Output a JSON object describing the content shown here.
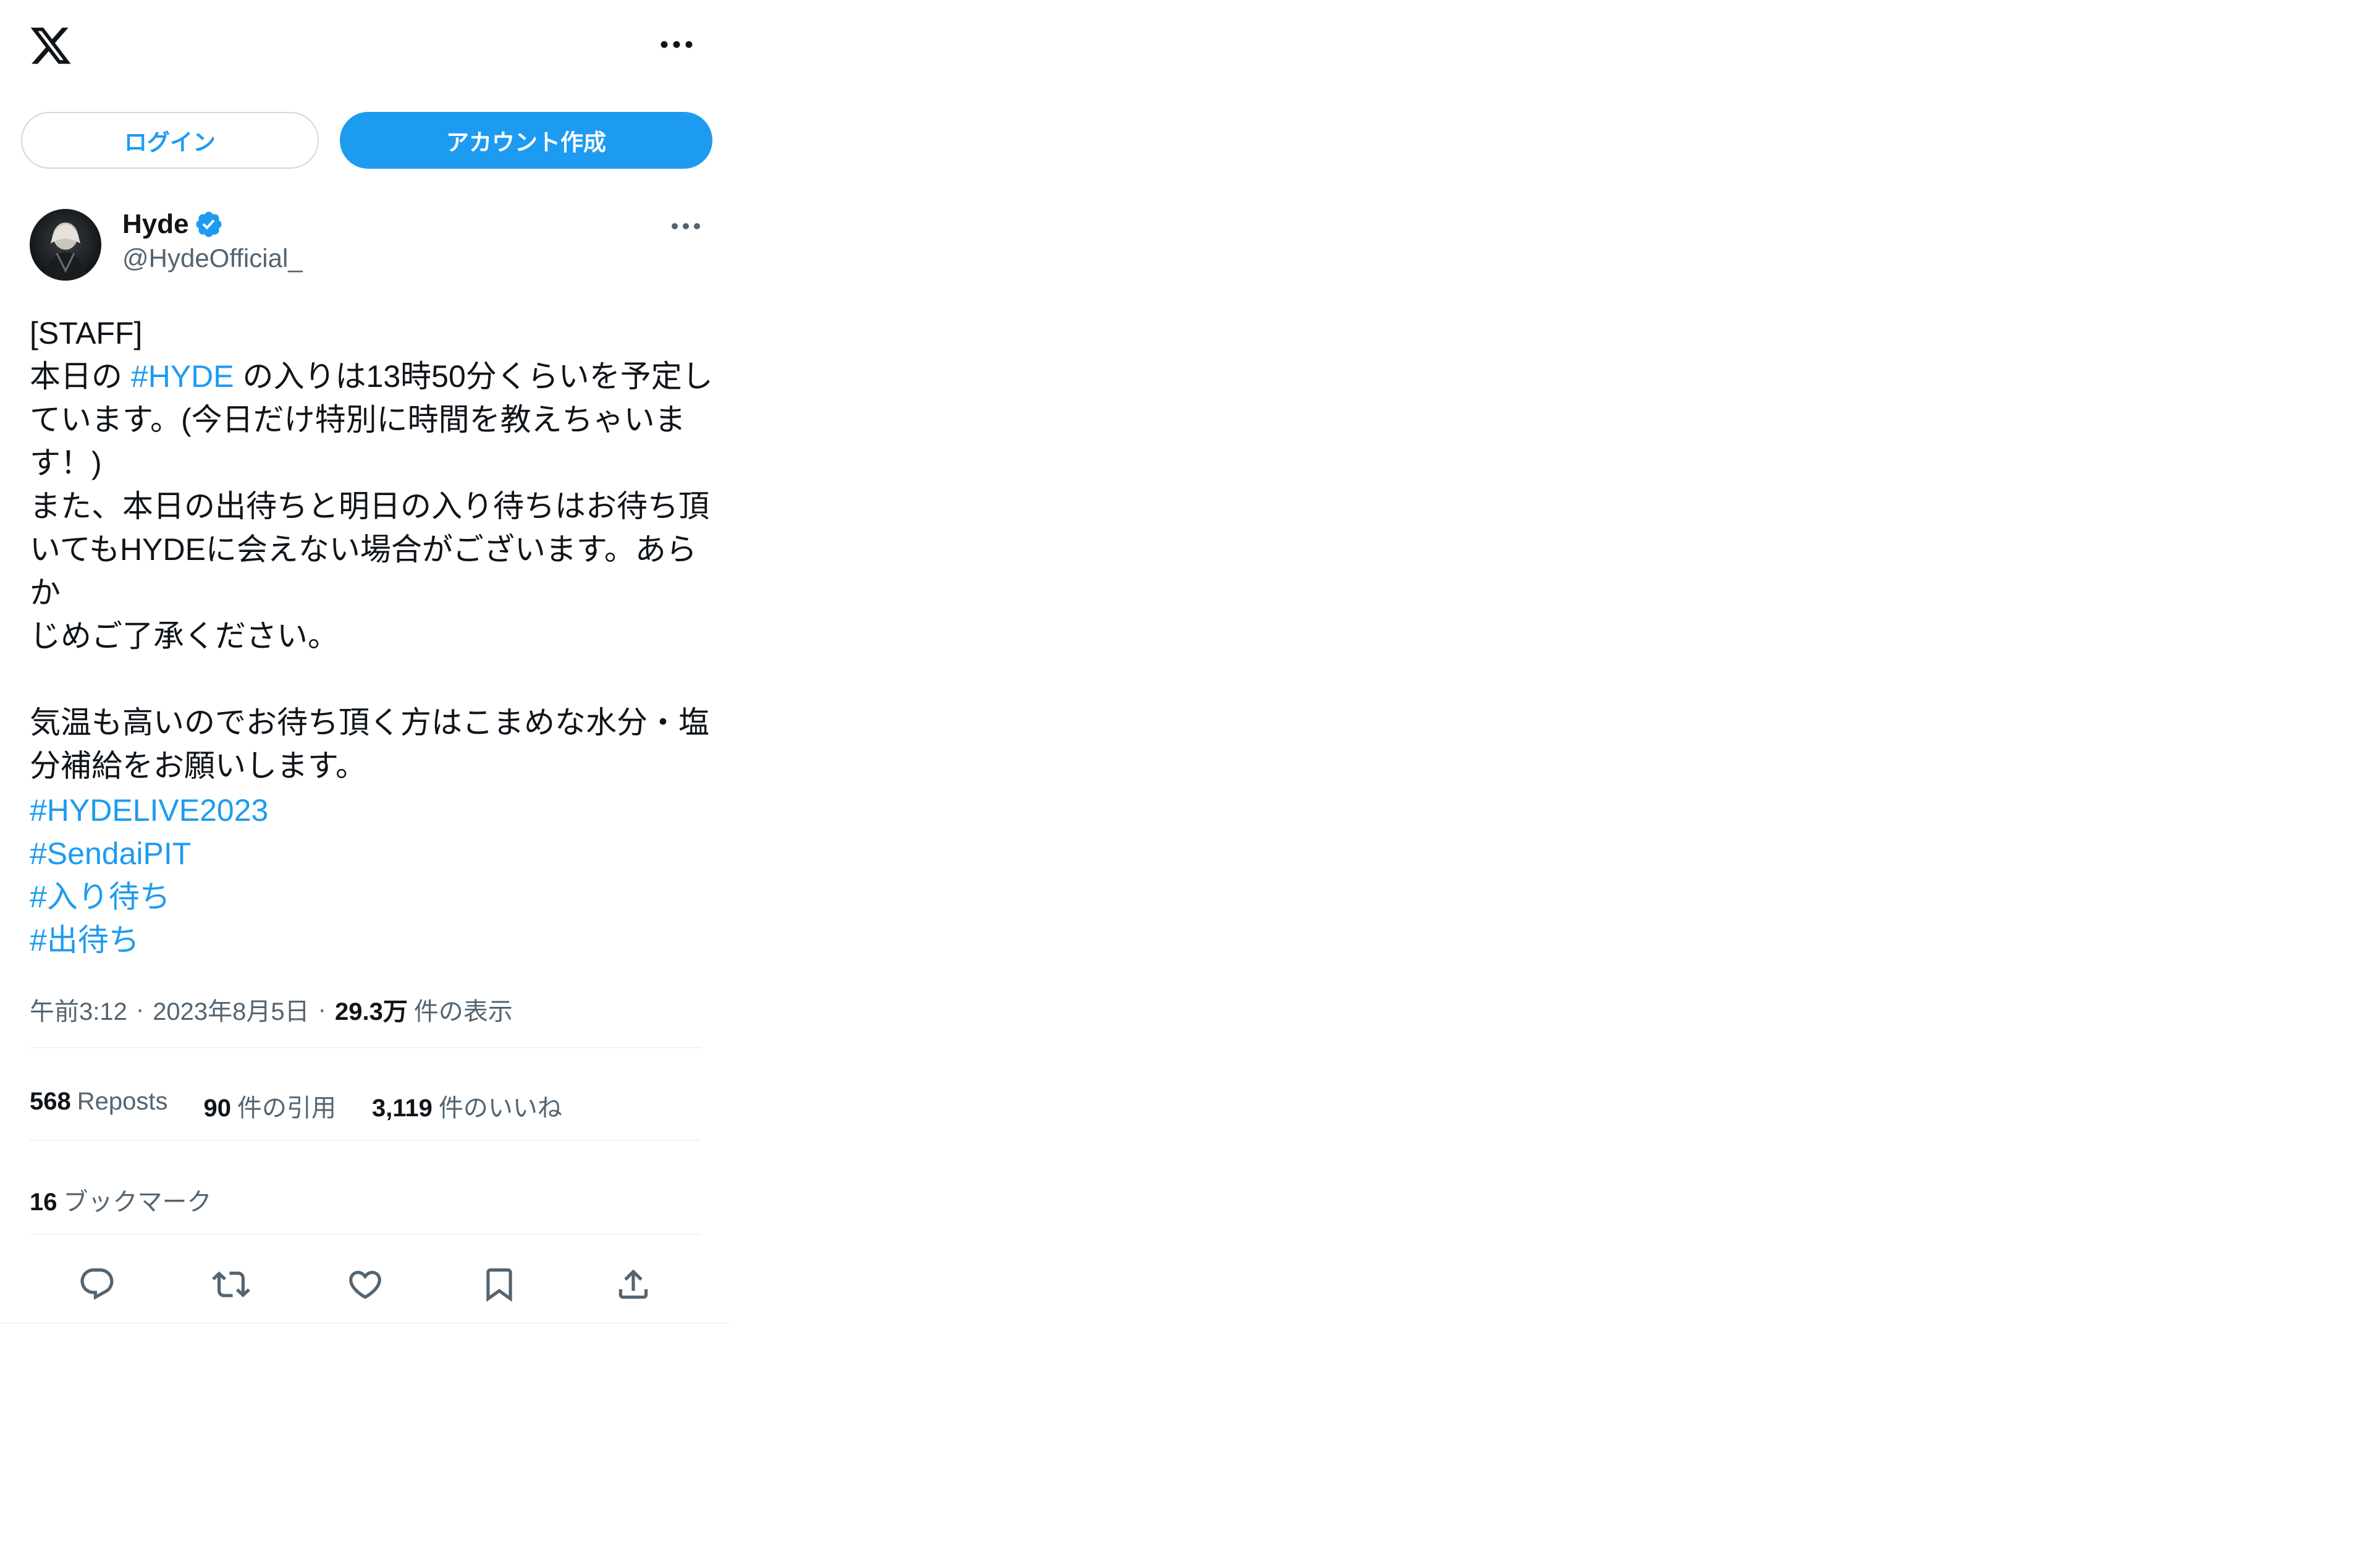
{
  "header": {
    "logo_icon": "x-logo-icon",
    "more_icon": "more-horizontal-icon"
  },
  "auth": {
    "login_label": "ログイン",
    "signup_label": "アカウント作成"
  },
  "tweet": {
    "author": {
      "name": "Hyde",
      "handle": "@HydeOfficial_",
      "verified_icon": "verified-badge-icon"
    },
    "text": {
      "line1": "[STAFF]",
      "line2_pre": "本日の ",
      "line2_tag": "#HYDE",
      "line2_post": " の入りは13時50分くらいを予定し\nています。(今日だけ特別に時間を教えちゃいま\nす！)\nまた、本日の出待ちと明日の入り待ちはお待ち頂\nいてもHYDEに会えない場合がございます。あらか\nじめご了承ください。\n\n気温も高いのでお待ち頂く方はこまめな水分・塩\n分補給をお願いします。"
    },
    "hashtags": [
      "#HYDELIVE2023",
      "#SendaiPIT",
      "#入り待ち",
      "#出待ち"
    ],
    "meta": {
      "time": "午前3:12",
      "date": "2023年8月5日",
      "views_count": "29.3万",
      "views_label": "件の表示"
    },
    "stats": {
      "reposts_count": "568",
      "reposts_label": "Reposts",
      "quotes_count": "90",
      "quotes_label": "件の引用",
      "likes_count": "3,119",
      "likes_label": "件のいいね",
      "bookmarks_count": "16",
      "bookmarks_label": "ブックマーク"
    },
    "actions": [
      "reply-icon",
      "repost-icon",
      "like-icon",
      "bookmark-icon",
      "share-icon"
    ]
  },
  "colors": {
    "accent": "#1d9bf0",
    "text": "#0f1419",
    "secondary": "#536471",
    "border": "#eff3f4"
  }
}
